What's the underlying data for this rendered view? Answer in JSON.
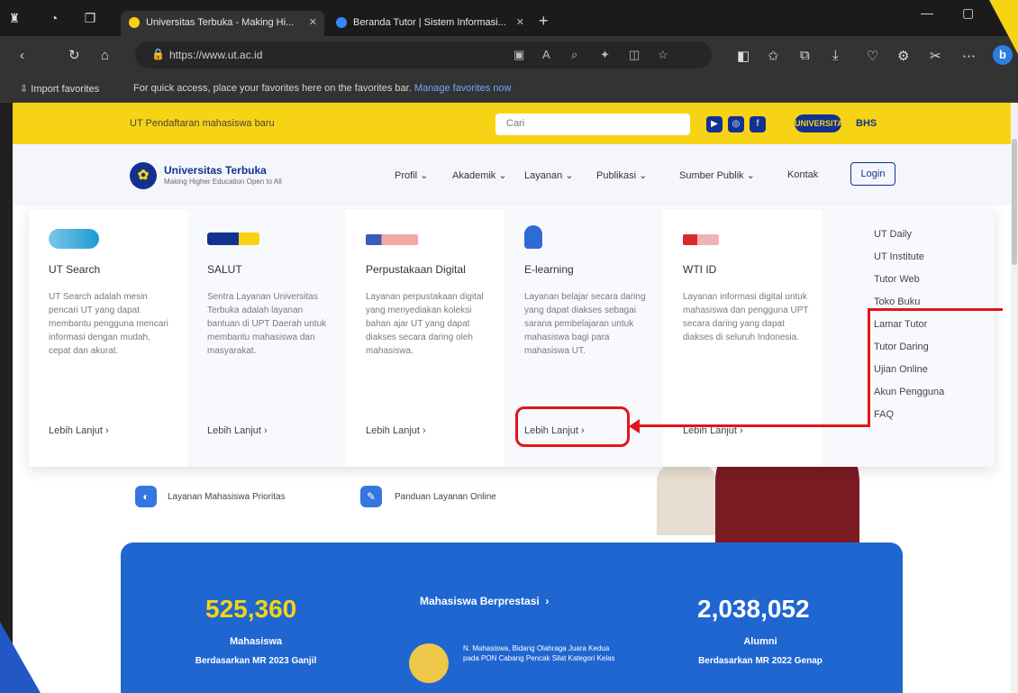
{
  "browser": {
    "tabs": [
      {
        "label": "Universitas Terbuka - Making Hi...",
        "active": true,
        "favicon_color": "#f7d315"
      },
      {
        "label": "Beranda Tutor | Sistem Informasi...",
        "active": false,
        "favicon_color": "#3a86ff"
      }
    ],
    "url": "https://www.ut.ac.id",
    "favorites": {
      "import_label": "Import favorites",
      "message": "For quick access, place your favorites here on the favorites bar.",
      "manage_link": "Manage favorites now"
    }
  },
  "site": {
    "tagline": "UT Pendaftaran mahasiswa baru",
    "search_placeholder": "Cari",
    "badge": "UNIVERSITAS",
    "lang": "BHS",
    "logo_name": "Universitas Terbuka",
    "logo_sub": "Making Higher Education Open to All",
    "nav": [
      "Profil",
      "Akademik",
      "Layanan",
      "Publikasi",
      "Sumber Publik",
      "Kontak"
    ],
    "login": "Login"
  },
  "dropdown": {
    "columns": [
      {
        "title": "UT Search",
        "desc": "UT Search adalah mesin pencari UT yang dapat membantu pengguna mencari informasi dengan mudah, cepat dan akurat.",
        "more": "Lebih Lanjut"
      },
      {
        "title": "SALUT",
        "desc": "Sentra Layanan Universitas Terbuka adalah layanan bantuan di UPT Daerah untuk membantu mahasiswa dan masyarakat.",
        "more": "Lebih Lanjut"
      },
      {
        "title": "Perpustakaan Digital",
        "desc": "Layanan perpustakaan digital yang menyediakan koleksi bahan ajar UT yang dapat diakses secara daring oleh mahasiswa.",
        "more": "Lebih Lanjut"
      },
      {
        "title": "E-learning",
        "desc": "Layanan belajar secara daring yang dapat diakses sebagai sarana pembelajaran untuk mahasiswa bagi para mahasiswa UT.",
        "more": "Lebih Lanjut"
      },
      {
        "title": "WTI ID",
        "desc": "Layanan informasi digital untuk mahasiswa dan pengguna UPT secara daring yang dapat diakses di seluruh Indonesia.",
        "more": "Lebih Lanjut"
      }
    ],
    "links": [
      "UT Daily",
      "UT Institute",
      "Tutor Web",
      "Toko Buku",
      "Lamar Tutor",
      "Tutor Daring",
      "Ujian Online",
      "Akun Pengguna",
      "FAQ"
    ]
  },
  "hero": {
    "item1": "Layanan Mahasiswa Prioritas",
    "item2": "Panduan Layanan Online"
  },
  "stats": {
    "left": {
      "number": "525,360",
      "line1": "Mahasiswa",
      "line2": "Berdasarkan MR 2023 Ganjil",
      "color": "#f7d315"
    },
    "middle": {
      "title": "Mahasiswa Berprestasi",
      "text": "N. Mahasiswa, Bidang Olahraga Juara Kedua pada PON Cabang Pencak Silat Kategori Kelas"
    },
    "right": {
      "number": "2,038,052",
      "line1": "Alumni",
      "line2": "Berdasarkan MR 2022 Genap",
      "color": "#ffffff"
    }
  },
  "colors": {
    "accent_yellow": "#f7d315",
    "brand_blue": "#13318f",
    "annotation_red": "#e4141b"
  }
}
